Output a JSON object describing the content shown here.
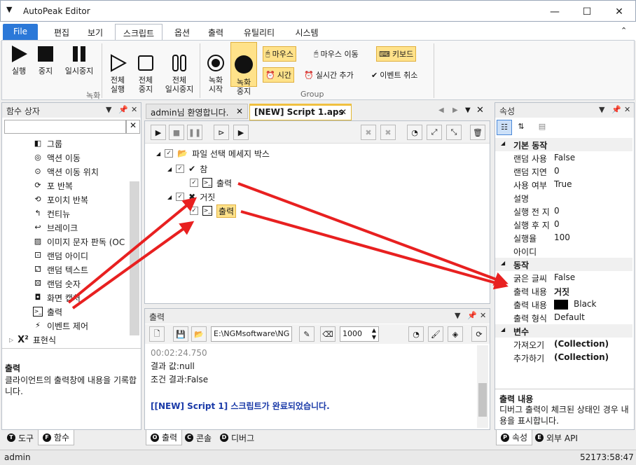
{
  "app": {
    "title": "AutoPeak Editor"
  },
  "ribbon_tabs": [
    "File",
    "편집",
    "보기",
    "스크립트",
    "옵션",
    "출력",
    "유틸리티",
    "시스템"
  ],
  "ribbon": {
    "rec_group": {
      "run": "실행",
      "stop": "중지",
      "pause": "일시중지",
      "run_all": "전체\n실행",
      "stop_all": "전체\n중지",
      "pause_all": "전체\n일시중지",
      "label": "녹화"
    },
    "group": {
      "rec_start": "녹화\n시작",
      "rec_stop": "녹화\n중지",
      "mouse": "마우스",
      "mouse_move": "마우스 이동",
      "keyboard": "키보드",
      "time": "시간",
      "realtime_add": "실시간 추가",
      "event_cancel": "이벤트 취소",
      "label": "Group"
    }
  },
  "left_panel": {
    "title": "함수 상자",
    "items": [
      "그룹",
      "액션 이동",
      "액션 이동 위치",
      "포 반복",
      "포이치 반복",
      "컨티뉴",
      "브레이크",
      "이미지 문자 판독 (OC",
      "랜덤 아이디",
      "랜덤 텍스트",
      "랜덤 숫자",
      "화면 캡처",
      "출력",
      "이벤트 제어",
      "표현식"
    ],
    "desc_title": "출력",
    "desc_text": "클라이언트의 출력창에 내용을 기록합니다.",
    "tabs": [
      "도구",
      "함수"
    ]
  },
  "doc_tabs": [
    "admin님 환영합니다.",
    "[NEW] Script 1.aps"
  ],
  "script_tree": {
    "root": "파일 선택 메세지 박스",
    "true_branch": "참",
    "out1": "출력",
    "false_branch": "거짓",
    "out2": "출력"
  },
  "output_panel": {
    "title": "출력",
    "path": "E:\\NGMsoftware\\NG",
    "delay": "1000",
    "lines": [
      "00:02:24.750",
      "결과 값:null",
      "조건 결과:False",
      "",
      "[[NEW] Script 1] 스크립트가 완료되었습니다."
    ],
    "tabs": [
      "출력",
      "콘솔",
      "디버그"
    ]
  },
  "props_panel": {
    "title": "속성",
    "sections": [
      {
        "name": "기본 동작",
        "rows": [
          [
            "랜덤 사용",
            "False"
          ],
          [
            "랜덤 지연",
            "0"
          ],
          [
            "사용 여부",
            "True"
          ],
          [
            "설명",
            ""
          ],
          [
            "실행 전 지",
            "0"
          ],
          [
            "실행 후 지",
            "0"
          ],
          [
            "실행율",
            "100"
          ],
          [
            "아이디",
            ""
          ]
        ]
      },
      {
        "name": "동작",
        "rows": [
          [
            "굵은 글씨",
            "False"
          ],
          [
            "출력 내용",
            "거짓"
          ],
          [
            "출력 내용",
            "Black"
          ],
          [
            "출력 형식",
            "Default"
          ]
        ]
      },
      {
        "name": "변수",
        "rows": [
          [
            "가져오기",
            "(Collection)"
          ],
          [
            "추가하기",
            "(Collection)"
          ]
        ]
      }
    ],
    "desc_title": "출력 내용",
    "desc_text": "디버그 출력이 체크된 상태인 경우 내용을 표시합니다.",
    "tabs": [
      "속성",
      "외부 API"
    ]
  },
  "status": {
    "user": "admin",
    "time": "52173:58:47"
  },
  "colors": {
    "accent": "#2b78d8",
    "highlight": "#ffe28a",
    "arrow": "#e82020"
  }
}
